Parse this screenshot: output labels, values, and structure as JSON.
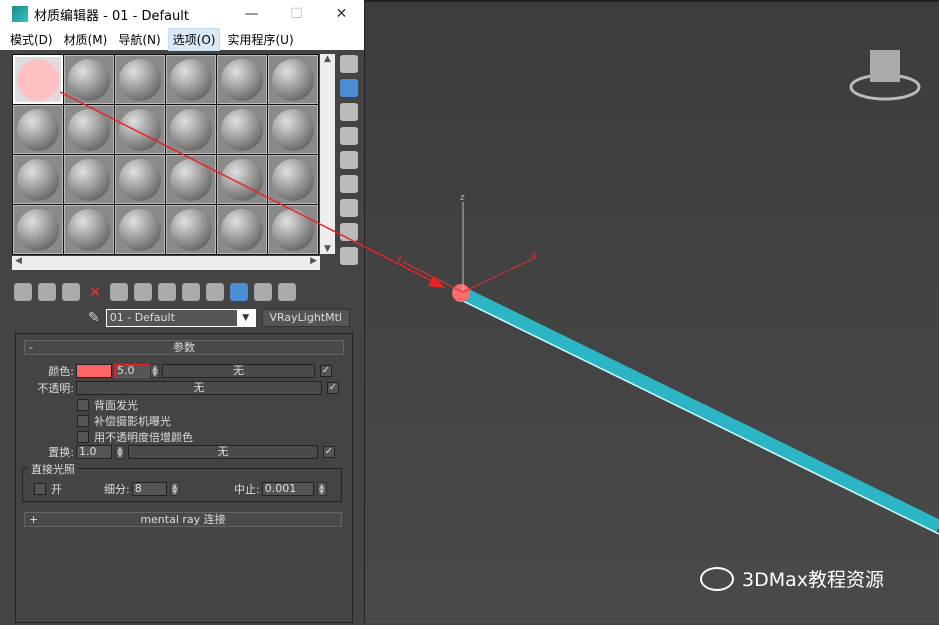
{
  "window": {
    "title": "材质编辑器 - 01 - Default",
    "minimize": "—",
    "maximize": "☐",
    "close": "✕"
  },
  "menu": [
    "模式(D)",
    "材质(M)",
    "导航(N)",
    "选项(O)",
    "实用程序(U)"
  ],
  "material": {
    "name": "01 - Default",
    "type": "VRayLightMtl"
  },
  "params": {
    "title": "参数",
    "collapse": "-",
    "color_label": "颜色:",
    "color_swatch": "#ff6464",
    "color_value": "5.0",
    "none": "无",
    "opacity_label": "不透明:",
    "backside": "背面发光",
    "compensate": "补偿摄影机曝光",
    "multiply": "用不透明度倍增颜色",
    "displace_label": "置换:",
    "displace_value": "1.0",
    "direct_title": "直接光照",
    "on_label": "开",
    "subdiv_label": "细分:",
    "subdiv_value": "8",
    "cutoff_label": "中止:",
    "cutoff_value": "0.001"
  },
  "mentalray": {
    "expand": "+",
    "title": "mental ray 连接"
  },
  "viewport": {
    "axis_x": "x",
    "axis_y": "y",
    "axis_z": "z",
    "tube_color": "#2bb5c5"
  },
  "watermark": "3DMax教程资源"
}
